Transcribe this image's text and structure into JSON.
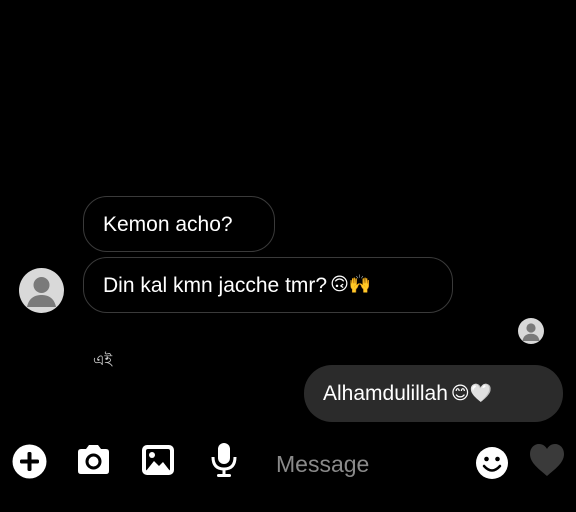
{
  "messages": [
    {
      "text": "Kemon acho?",
      "direction": "incoming"
    },
    {
      "text": "Din kal kmn jacche tmr?",
      "emoji": "🙃🙌",
      "direction": "incoming"
    },
    {
      "text": "Alhamdulillah",
      "emoji": "😊🤍",
      "direction": "outgoing"
    }
  ],
  "seen_label": "এই",
  "composer": {
    "placeholder": "Message",
    "icons": [
      "add-icon",
      "camera-icon",
      "gallery-icon",
      "microphone-icon",
      "emoji-icon",
      "heart-icon"
    ]
  },
  "colors": {
    "background": "#000000",
    "incoming_border": "#3a3a3a",
    "outgoing_bubble": "#2b2b2b",
    "placeholder": "#8a8a8a"
  }
}
